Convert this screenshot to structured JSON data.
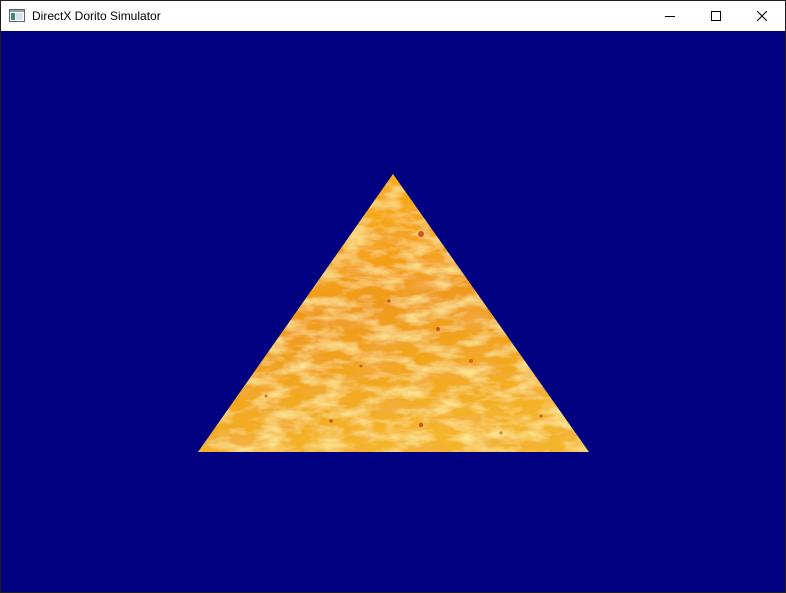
{
  "window": {
    "title": "DirectX Dorito Simulator",
    "app_icon": "application-window-icon",
    "controls": {
      "minimize_icon": "minimize-icon",
      "maximize_icon": "maximize-icon",
      "close_icon": "close-icon"
    }
  },
  "scene": {
    "clear_color": "#000080",
    "object": "textured-triangle",
    "texture": "dorito-chip-texture",
    "texture_colors": [
      "#f5a20f",
      "#fbd23c",
      "#e77a1a",
      "#b8361a"
    ]
  }
}
